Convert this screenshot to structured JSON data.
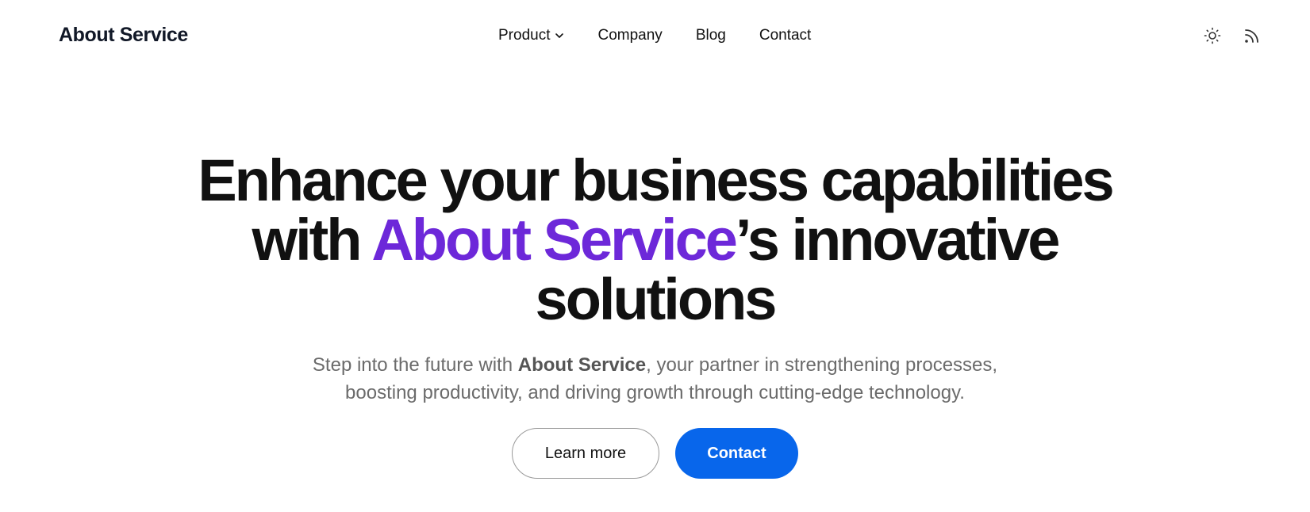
{
  "header": {
    "brand": "About Service",
    "nav": [
      {
        "label": "Product",
        "has_dropdown": true
      },
      {
        "label": "Company"
      },
      {
        "label": "Blog"
      },
      {
        "label": "Contact"
      }
    ],
    "icons": [
      "sun-icon",
      "rss-icon"
    ]
  },
  "hero": {
    "headline_part1": "Enhance your business capabilities with ",
    "headline_accent": "About Service",
    "headline_part2": "’s innovative solutions",
    "sub_part1": "Step into the future with ",
    "sub_bold": "About Service",
    "sub_part2": ", your partner in strengthening processes, boosting productivity, and driving growth through cutting-edge technology.",
    "buttons": {
      "learn_more": "Learn more",
      "contact": "Contact"
    }
  },
  "colors": {
    "accent": "#6d28d9",
    "primary_button": "#0866eb",
    "text": "#111111",
    "muted_text": "#6b6b6b"
  }
}
